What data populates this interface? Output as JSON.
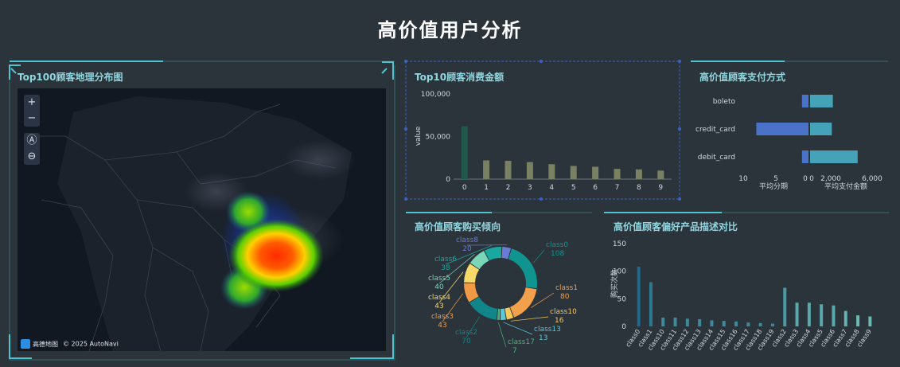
{
  "page": {
    "title": "高价值用户分析"
  },
  "map_panel": {
    "title": "Top100顾客地理分布图",
    "zoom_in": "+",
    "zoom_out": "−",
    "compass": "Ⓐ",
    "tilt": "⊖",
    "logo_text": "高德地图",
    "attribution": "© 2025 AutoNavi"
  },
  "top10_panel": {
    "title": "Top10顾客消费金额"
  },
  "payment_panel": {
    "title": "高价值顾客支付方式"
  },
  "purchase_panel": {
    "title": "高价值顾客购买倾向"
  },
  "product_panel": {
    "title": "高价值顾客偏好产品描述对比"
  },
  "chart_data": [
    {
      "type": "bar",
      "ylabel": "value",
      "categories": [
        "0",
        "1",
        "2",
        "3",
        "4",
        "5",
        "6",
        "7",
        "8",
        "9"
      ],
      "values": [
        62000,
        22000,
        21500,
        20000,
        17500,
        15500,
        14500,
        12000,
        11500,
        10000
      ],
      "ylim": [
        0,
        100000
      ],
      "yticks": [
        "0",
        "50,000",
        "100,000"
      ],
      "colors": [
        "#1f5a4a",
        "#7a8062",
        "#7a8062",
        "#7a8062",
        "#7a8062",
        "#7a8062",
        "#7a8062",
        "#7a8062",
        "#7a8062",
        "#7a8062"
      ]
    },
    {
      "type": "bar",
      "categories": [
        "boleto",
        "credit_card",
        "debit_card"
      ],
      "left_xlabel": "平均分期",
      "right_xlabel": "平均支付金额",
      "left_values": [
        1,
        8,
        1
      ],
      "right_values": [
        2200,
        2100,
        4600
      ],
      "left_ticks": [
        "10",
        "5",
        "0"
      ],
      "right_ticks": [
        "0",
        "2,000",
        "6,000"
      ],
      "left_color": "#4a72c8",
      "right_color": "#45a3b9"
    },
    {
      "type": "pie",
      "slices": [
        {
          "name": "class0",
          "value": 108,
          "color": "#0f9490"
        },
        {
          "name": "class1",
          "value": 80,
          "color": "#f2a04b"
        },
        {
          "name": "class10",
          "value": 16,
          "color": "#f6c85a"
        },
        {
          "name": "class13",
          "value": 13,
          "color": "#5cc7d6"
        },
        {
          "name": "class17",
          "value": 7,
          "color": "#49b37a"
        },
        {
          "name": "class2",
          "value": 70,
          "color": "#11868a"
        },
        {
          "name": "class3",
          "value": 43,
          "color": "#f09a45"
        },
        {
          "name": "class4",
          "value": 43,
          "color": "#f7d96a"
        },
        {
          "name": "class5",
          "value": 40,
          "color": "#7ad6b6"
        },
        {
          "name": "class6",
          "value": 38,
          "color": "#1aa7a0"
        },
        {
          "name": "class8",
          "value": 20,
          "color": "#6a7bd6"
        }
      ]
    },
    {
      "type": "bar",
      "ylabel": "购买次数",
      "categories": [
        "class0",
        "class1",
        "class10",
        "class11",
        "class12",
        "class13",
        "class14",
        "class15",
        "class16",
        "class17",
        "class18",
        "class19",
        "class2",
        "class3",
        "class4",
        "class5",
        "class6",
        "class7",
        "class8",
        "class9"
      ],
      "values": [
        108,
        80,
        16,
        16,
        14,
        13,
        11,
        10,
        9,
        7,
        6,
        5,
        70,
        43,
        43,
        40,
        38,
        28,
        20,
        18
      ],
      "ylim": [
        0,
        150
      ],
      "yticks": [
        "0",
        "50",
        "100",
        "150"
      ],
      "colors": [
        "#1c6b8c",
        "#2c7a92",
        "#3c8a9a",
        "#3c8a9a",
        "#3c8a9a",
        "#3c8a9a",
        "#3c8a9a",
        "#3c8a9a",
        "#3c8a9a",
        "#3c8a9a",
        "#3c8a9a",
        "#3c8a9a",
        "#4a9aa2",
        "#5aa8aa",
        "#5aa8aa",
        "#5aa8aa",
        "#5aa8aa",
        "#66b2ae",
        "#6cb8b2",
        "#6cb8b2"
      ]
    }
  ]
}
